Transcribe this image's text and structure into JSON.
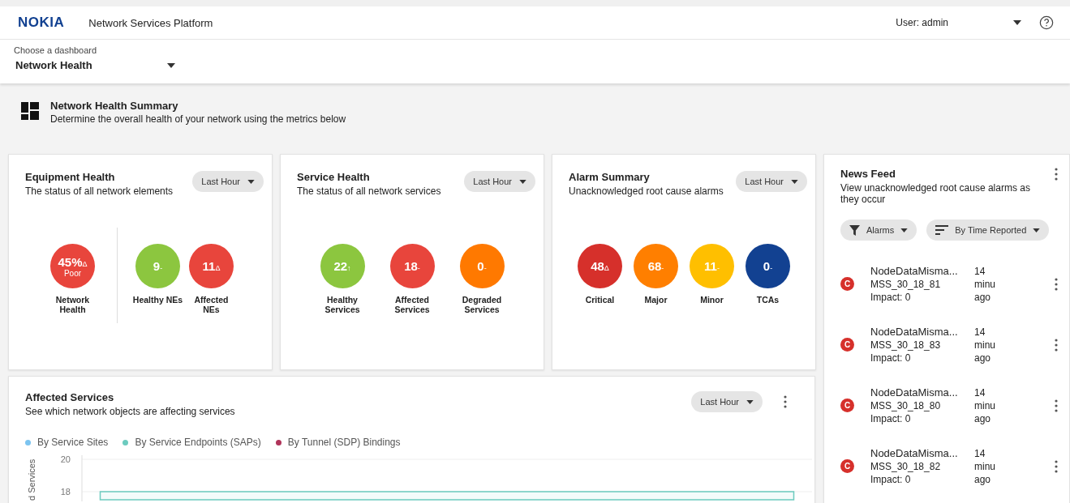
{
  "header": {
    "logo": "NOKIA",
    "title": "Network Services Platform",
    "user": "User: admin"
  },
  "dashboard_chooser": {
    "label": "Choose a dashboard",
    "value": "Network Health"
  },
  "summary": {
    "title": "Network Health Summary",
    "subtitle": "Determine the overall health of your network using the metrics below"
  },
  "cards": [
    {
      "title": "Equipment Health",
      "subtitle": "The status of all network elements",
      "period": "Last Hour",
      "groups": [
        [
          {
            "value": "45%",
            "trend": "Δ",
            "sub": "Poor",
            "label": "Network Health",
            "color": "#e8453c"
          }
        ],
        [
          {
            "value": "9",
            "trend": "-",
            "label": "Healthy NEs",
            "color": "#8cc63f"
          },
          {
            "value": "11",
            "trend": "Δ",
            "label": "Affected NEs",
            "color": "#e8453c"
          }
        ]
      ]
    },
    {
      "title": "Service Health",
      "subtitle": "The status of all network services",
      "period": "Last Hour",
      "groups": [
        [
          {
            "value": "22",
            "trend": "↑",
            "label": "Healthy Services",
            "color": "#8cc63f"
          },
          {
            "value": "18",
            "trend": "-",
            "label": "Affected Services",
            "color": "#e8453c"
          },
          {
            "value": "0",
            "trend": "-",
            "label": "Degraded Services",
            "color": "#ff7900"
          }
        ]
      ]
    },
    {
      "title": "Alarm Summary",
      "subtitle": "Unacknowledged root cause alarms",
      "period": "Last Hour",
      "groups": [
        [
          {
            "value": "48",
            "trend": "Δ",
            "label": "Critical",
            "color": "#d6302b"
          },
          {
            "value": "68",
            "trend": "-",
            "label": "Major",
            "color": "#ff7f00"
          },
          {
            "value": "11",
            "trend": "-",
            "label": "Minor",
            "color": "#ffbf00"
          },
          {
            "value": "0",
            "trend": "-",
            "label": "TCAs",
            "color": "#124191"
          }
        ]
      ]
    }
  ],
  "affected_services": {
    "title": "Affected Services",
    "subtitle": "See which network objects are affecting services",
    "period": "Last Hour",
    "chart_data": {
      "type": "area",
      "categories": [
        null,
        null,
        null,
        null,
        null,
        null,
        null,
        null,
        null,
        null,
        null,
        null,
        null,
        null,
        null,
        null,
        null,
        null,
        null,
        null
      ],
      "ylabel": "d Services",
      "ylim": [
        17.5,
        20
      ],
      "yticks": [
        18,
        20
      ],
      "series": [
        {
          "name": "By Service Sites",
          "color": "#7cc4f0",
          "values": [
            null,
            null,
            null,
            null,
            null,
            null,
            null,
            null,
            null,
            null,
            null,
            null,
            null,
            null,
            null,
            null,
            null,
            null,
            null,
            null
          ]
        },
        {
          "name": "By Service Endpoints (SAPs)",
          "color": "#6ccbbf",
          "values": [
            18,
            18,
            18,
            18,
            18,
            18,
            18,
            18,
            18,
            18,
            18,
            18,
            18,
            18,
            18,
            18,
            18,
            18,
            18,
            18
          ]
        },
        {
          "name": "By Tunnel (SDP) Bindings",
          "color": "#b0345a",
          "values": [
            null,
            null,
            null,
            null,
            null,
            null,
            null,
            null,
            null,
            null,
            null,
            null,
            null,
            null,
            null,
            null,
            null,
            null,
            null,
            null
          ]
        }
      ]
    }
  },
  "news_feed": {
    "title": "News Feed",
    "subtitle": "View unacknowledged root cause alarms as they occur",
    "filters": [
      {
        "kind": "filter",
        "label": "Alarms"
      },
      {
        "kind": "sort",
        "label": "By Time Reported"
      }
    ],
    "items": [
      {
        "severity": "C",
        "title": "NodeDataMisma...",
        "object": "MSS_30_18_81",
        "impact": "Impact: 0",
        "time": "14 minu ago"
      },
      {
        "severity": "C",
        "title": "NodeDataMisma...",
        "object": "MSS_30_18_83",
        "impact": "Impact: 0",
        "time": "14 minu ago"
      },
      {
        "severity": "C",
        "title": "NodeDataMisma...",
        "object": "MSS_30_18_80",
        "impact": "Impact: 0",
        "time": "14 minu ago"
      },
      {
        "severity": "C",
        "title": "NodeDataMisma...",
        "object": "MSS_30_18_82",
        "impact": "Impact: 0",
        "time": "14 minu ago"
      }
    ]
  }
}
